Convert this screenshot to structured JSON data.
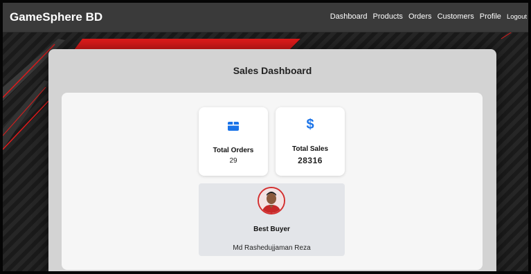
{
  "navbar": {
    "brand": "GameSphere BD",
    "links": [
      "Dashboard",
      "Products",
      "Orders",
      "Customers",
      "Profile",
      "Logout"
    ]
  },
  "dashboard": {
    "title": "Sales Dashboard",
    "orders": {
      "icon": "box-icon",
      "label": "Total Orders",
      "value": "29"
    },
    "sales": {
      "icon": "dollar-icon",
      "symbol": "$",
      "label": "Total Sales",
      "value": "28316"
    },
    "best_buyer": {
      "label": "Best Buyer",
      "name": "Md Rashedujjaman Reza"
    }
  },
  "colors": {
    "accent": "#1a73e8",
    "navbar": "#3a3a3a",
    "stripe_red": "#e01b1b",
    "panel": "#d3d3d3"
  }
}
